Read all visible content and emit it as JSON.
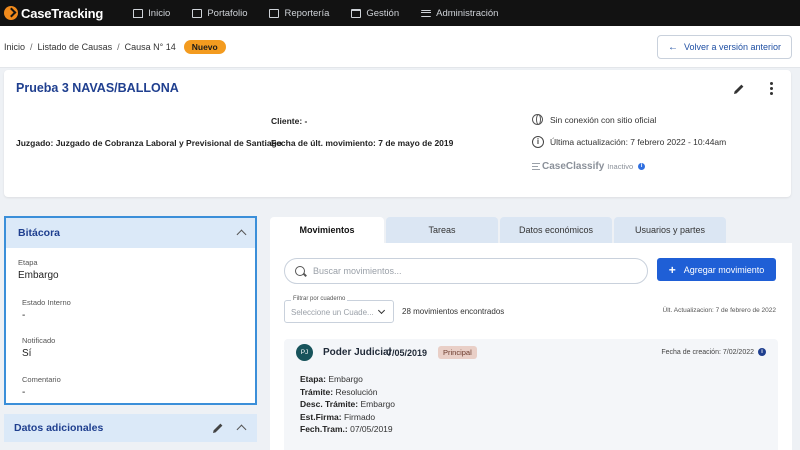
{
  "app": {
    "logo": "CaseTracking",
    "brand_color": "#f08a1c",
    "accent": "#1f5fd6"
  },
  "nav": [
    {
      "label": "Inicio",
      "icon": "home-icon"
    },
    {
      "label": "Portafolio",
      "icon": "briefcase-icon"
    },
    {
      "label": "Reportería",
      "icon": "report-icon"
    },
    {
      "label": "Gestión",
      "icon": "folder-icon"
    },
    {
      "label": "Administración",
      "icon": "menu-icon"
    }
  ],
  "breadcrumb": {
    "items": [
      "Inicio",
      "Listado de Causas",
      "Causa N° 14"
    ],
    "badge": "Nuevo"
  },
  "back_button": {
    "label": "Volver a versión anterior"
  },
  "case": {
    "title": "Prueba 3 NAVAS/BALLONA",
    "juzgado_label": "Juzgado:",
    "juzgado_value": "Juzgado de Cobranza Laboral y Previsional de Santiago",
    "cliente_label": "Cliente:",
    "cliente_value": "-",
    "fecha_label": "Fecha de últ. movimiento:",
    "fecha_value": "7 de mayo de 2019",
    "sync_status": "Sin conexión con sitio oficial",
    "last_update": "Última actualización: 7 febrero 2022 - 10:44am",
    "caseclassify_logo": "CaseClassify",
    "caseclassify_status": "Inactivo"
  },
  "bitacora": {
    "title": "Bitácora",
    "fields": [
      {
        "label": "Etapa",
        "value": "Embargo"
      },
      {
        "label": "Estado Interno",
        "value": "-"
      },
      {
        "label": "Notificado",
        "value": "Sí"
      },
      {
        "label": "Comentario",
        "value": "-"
      }
    ]
  },
  "datos_adicionales": {
    "title": "Datos adicionales"
  },
  "tabs": [
    {
      "label": "Movimientos",
      "active": true
    },
    {
      "label": "Tareas",
      "active": false
    },
    {
      "label": "Datos económicos",
      "active": false
    },
    {
      "label": "Usuarios y partes",
      "active": false
    }
  ],
  "movimientos": {
    "search_placeholder": "Buscar movimientos...",
    "add_label": "Agregar movimiento",
    "filter_legend": "Filtrar por cuaderno",
    "filter_placeholder": "Seleccione un Cuade...",
    "count_text": "28 movimientos encontrados",
    "last_update_text": "Últ. Actualizacion: 7 de febrero de 2022"
  },
  "movement": {
    "avatar": "PJ",
    "source": "Poder Judicial",
    "date": "7/05/2019",
    "tag": "Principal",
    "created": "Fecha de creación: 7/02/2022",
    "lines": [
      {
        "key": "Etapa:",
        "value": "Embargo"
      },
      {
        "key": "Trámite:",
        "value": "Resolución"
      },
      {
        "key": "Desc. Trámite:",
        "value": "Embargo"
      },
      {
        "key": "Est.Firma:",
        "value": "Firmado"
      },
      {
        "key": "Fech.Tram.:",
        "value": "07/05/2019"
      }
    ]
  }
}
